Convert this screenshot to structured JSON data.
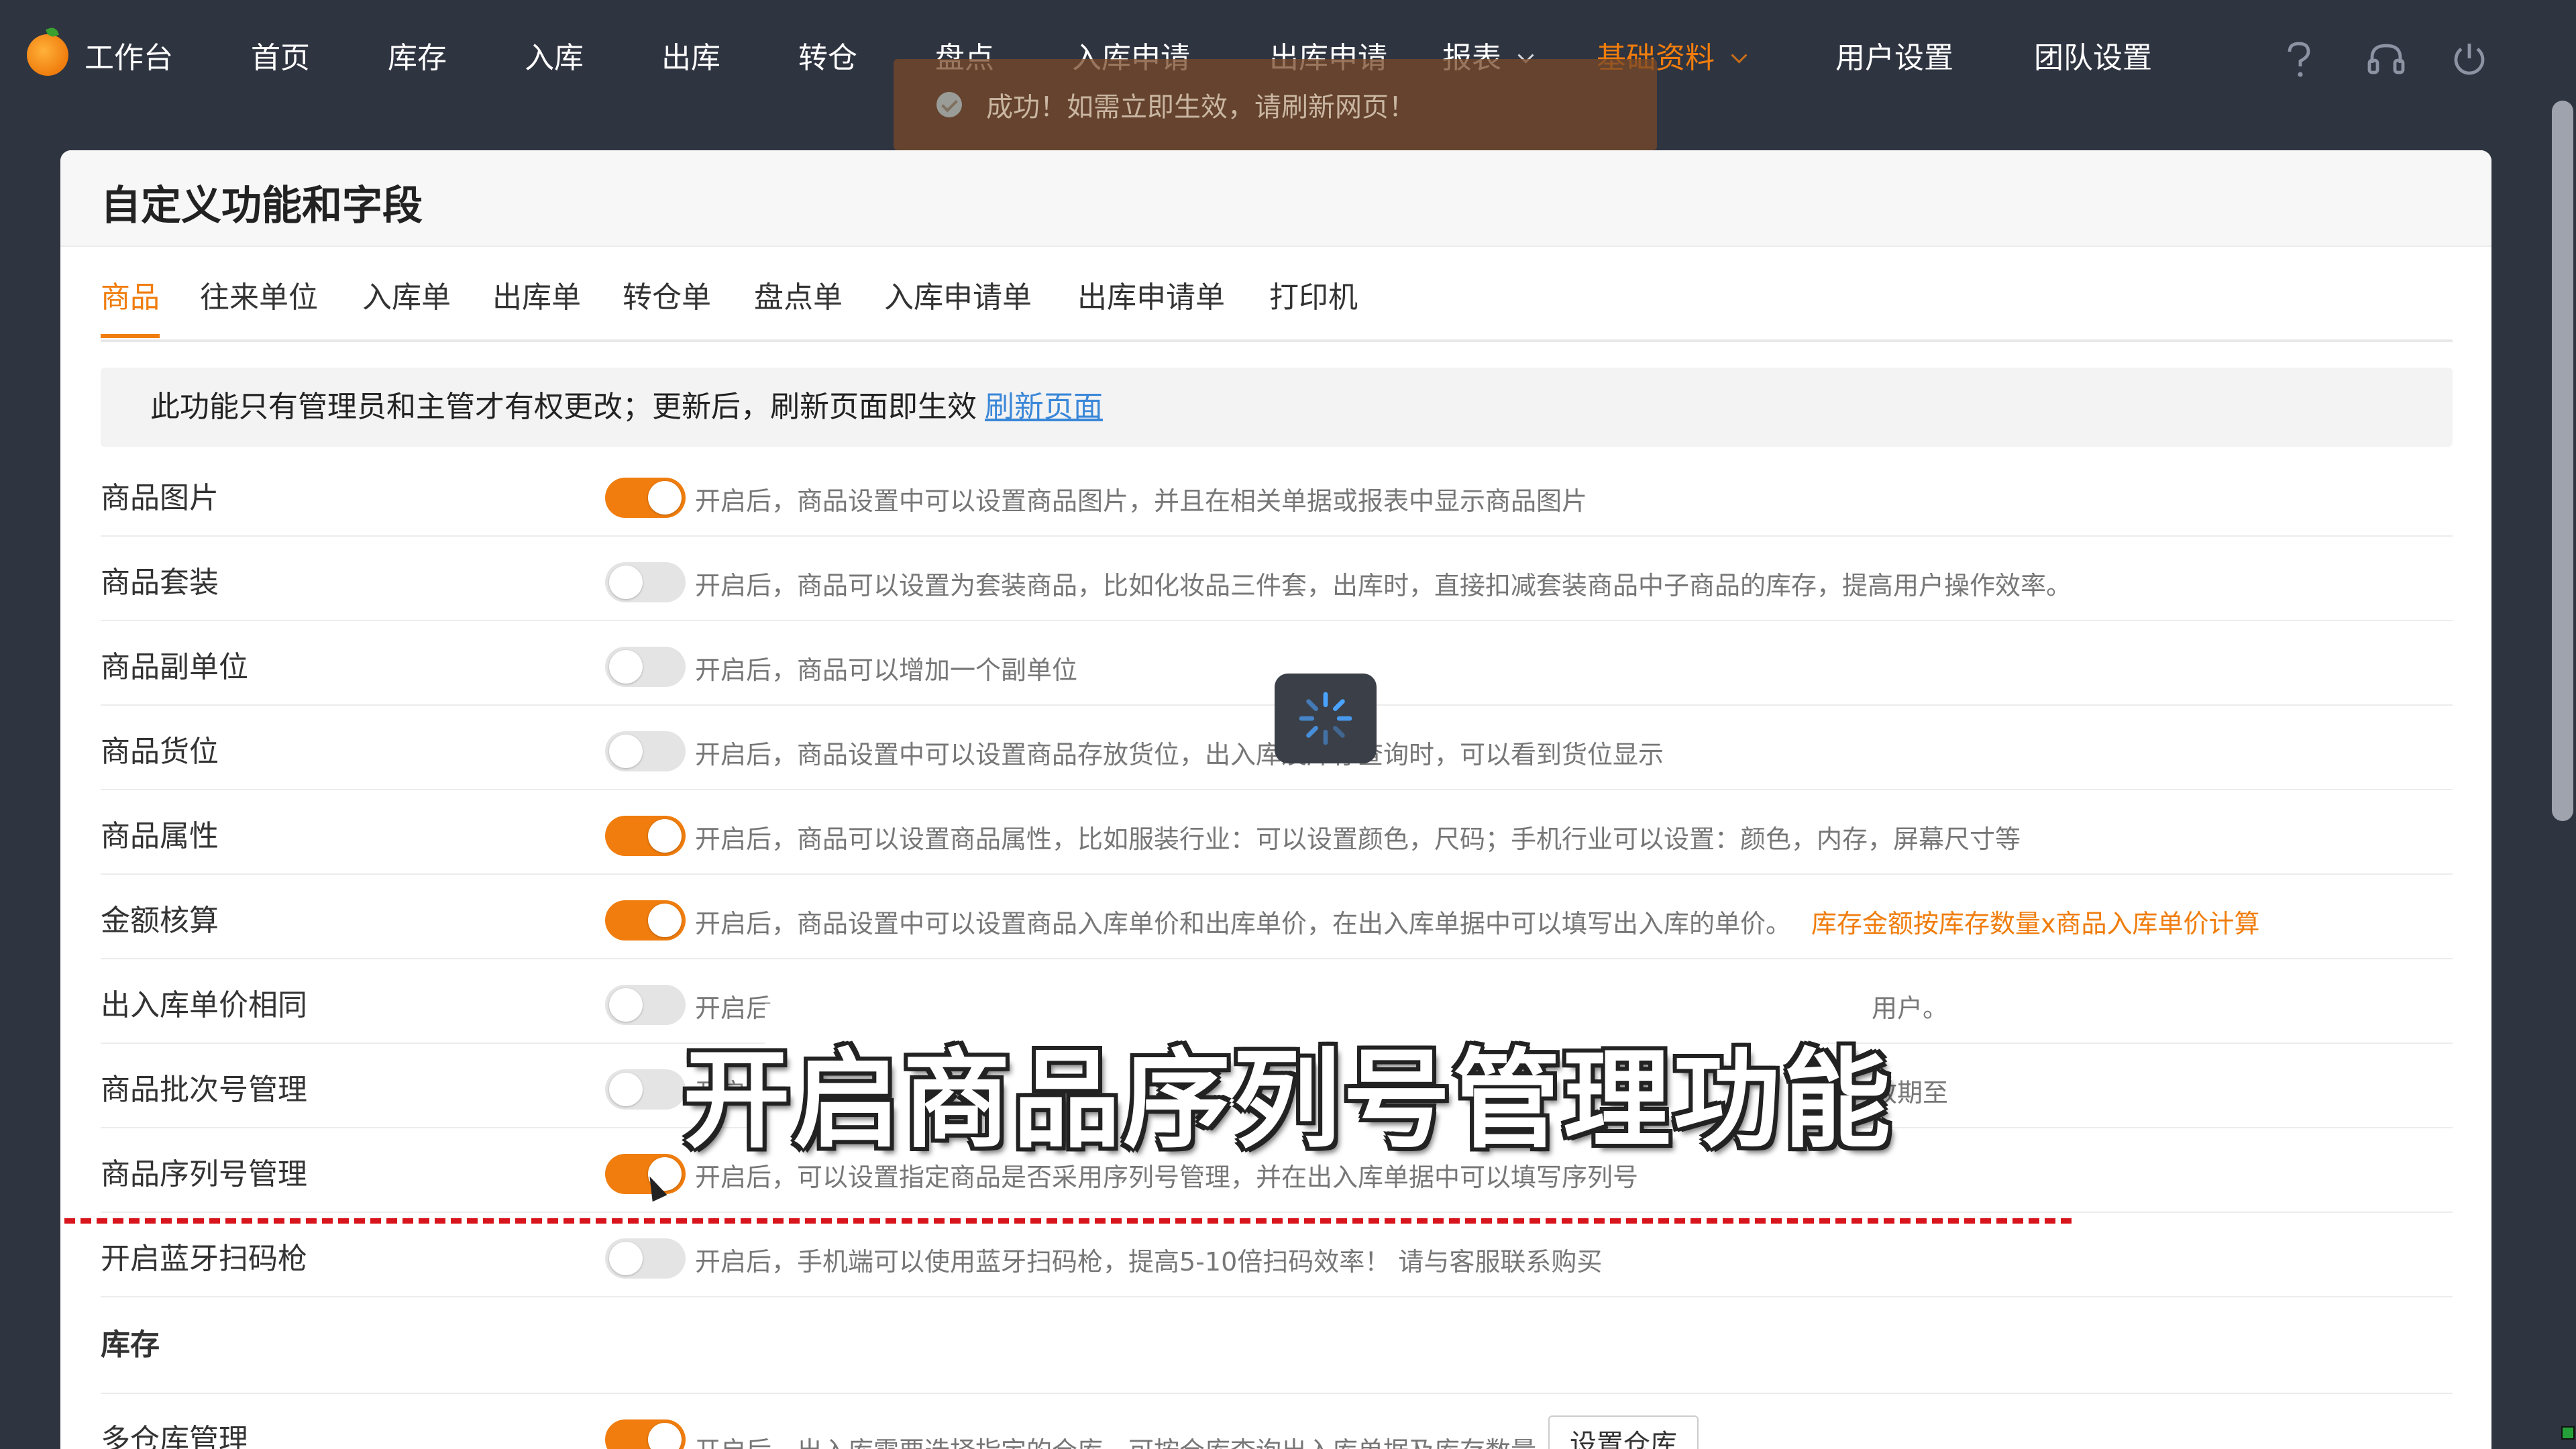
{
  "app": {
    "name": "工作台"
  },
  "nav": [
    {
      "label": "首页"
    },
    {
      "label": "库存"
    },
    {
      "label": "入库"
    },
    {
      "label": "出库"
    },
    {
      "label": "转仓"
    },
    {
      "label": "盘点"
    },
    {
      "label": "入库申请"
    },
    {
      "label": "出库申请"
    },
    {
      "label": "报表"
    },
    {
      "label": "基础资料"
    },
    {
      "label": "用户设置"
    },
    {
      "label": "团队设置"
    }
  ],
  "toast": {
    "text": "成功！如需立即生效，请刷新网页！"
  },
  "page": {
    "title": "自定义功能和字段"
  },
  "tabs": [
    {
      "label": "商品"
    },
    {
      "label": "往来单位"
    },
    {
      "label": "入库单"
    },
    {
      "label": "出库单"
    },
    {
      "label": "转仓单"
    },
    {
      "label": "盘点单"
    },
    {
      "label": "入库申请单"
    },
    {
      "label": "出库申请单"
    },
    {
      "label": "打印机"
    }
  ],
  "notice": {
    "text": "此功能只有管理员和主管才有权更改；更新后，刷新页面即生效",
    "link": "刷新页面"
  },
  "settings": [
    {
      "label": "商品图片",
      "on": true,
      "desc": "开启后，商品设置中可以设置商品图片，并且在相关单据或报表中显示商品图片"
    },
    {
      "label": "商品套装",
      "on": false,
      "desc": "开启后，商品可以设置为套装商品，比如化妆品三件套，出库时，直接扣减套装商品中子商品的库存，提高用户操作效率。"
    },
    {
      "label": "商品副单位",
      "on": false,
      "desc": "开启后，商品可以增加一个副单位"
    },
    {
      "label": "商品货位",
      "on": false,
      "desc": "开启后，商品设置中可以设置商品存放货位，出入库及库存查询时，可以看到货位显示"
    },
    {
      "label": "商品属性",
      "on": true,
      "desc": "开启后，商品可以设置商品属性，比如服装行业：可以设置颜色，尺码；手机行业可以设置：颜色，内存，屏幕尺寸等"
    },
    {
      "label": "金额核算",
      "on": true,
      "desc": "开启后，商品设置中可以设置商品入库单价和出库单价，在出入库单据中可以填写出入库的单价。",
      "note": "库存金额按库存数量x商品入库单价计算"
    },
    {
      "label": "出入库单价相同",
      "on": false,
      "desc": "开启后",
      "tail": "用户。"
    },
    {
      "label": "商品批次号管理",
      "on": false,
      "desc": "开启后",
      "tail": "效期至"
    },
    {
      "label": "商品序列号管理",
      "on": true,
      "desc": "开启后，可以设置指定商品是否采用序列号管理，并在出入库单据中可以填写序列号"
    },
    {
      "label": "开启蓝牙扫码枪",
      "on": false,
      "desc": "开启后，手机端可以使用蓝牙扫码枪，提高5-10倍扫码效率！ 请与客服联系购买"
    }
  ],
  "section2": {
    "title": "库存"
  },
  "warehouse": {
    "label": "多仓库管理",
    "on": true,
    "desc": "开启后，出入库需要选择指定的仓库，可按仓库查询出入库单据及库存数量",
    "button": "设置仓库"
  },
  "subtitle": {
    "text": "开启商品序列号管理功能"
  },
  "colors": {
    "accent": "#f07d0d",
    "nav_bg": "#2f3441",
    "link": "#3a87d8",
    "annotation_line": "#d8141c"
  }
}
